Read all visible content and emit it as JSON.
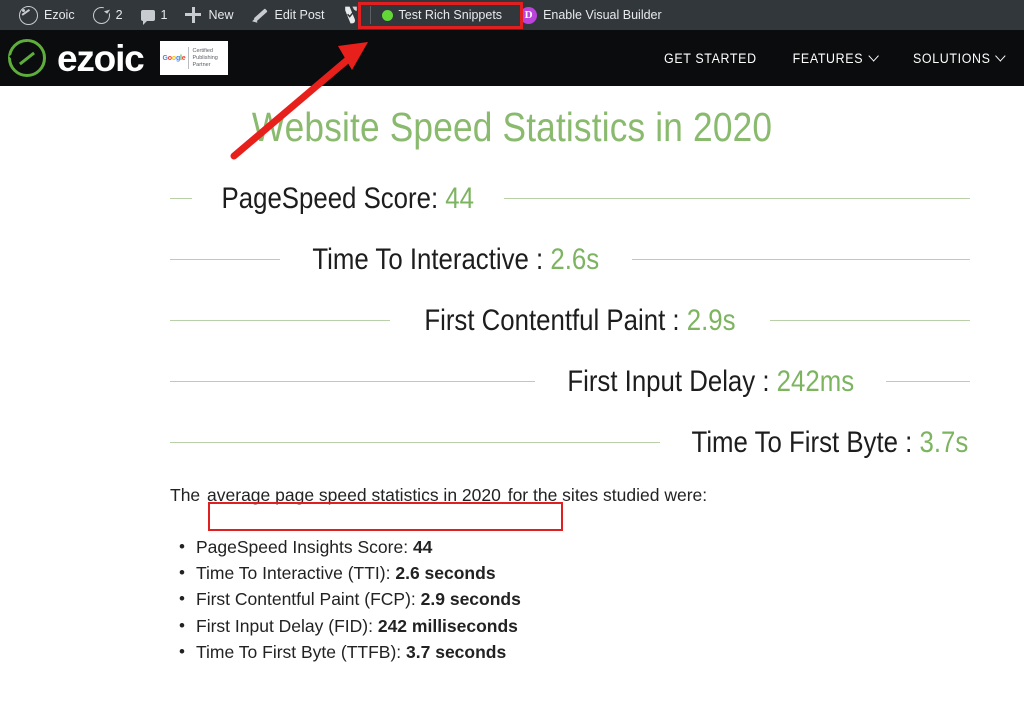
{
  "admin_bar": {
    "items": [
      {
        "icon": "ezoic-speedometer-icon",
        "label": "Ezoic",
        "name": "admin-bar-item-ezoic"
      },
      {
        "icon": "updates-refresh-icon",
        "label": "2",
        "name": "admin-bar-item-updates"
      },
      {
        "icon": "comment-bubble-icon",
        "label": "1",
        "name": "admin-bar-item-comments"
      },
      {
        "icon": "plus-icon",
        "label": "New",
        "name": "admin-bar-item-new"
      },
      {
        "icon": "pencil-icon",
        "label": "Edit Post",
        "name": "admin-bar-item-edit-post"
      },
      {
        "icon": "yoast-seo-icon",
        "label": "",
        "name": "admin-bar-item-yoast"
      },
      {
        "icon": "green-status-dot-icon",
        "label": "Test Rich Snippets",
        "name": "admin-bar-item-test-rich-snippets"
      },
      {
        "icon": "divi-d-icon",
        "label": "Enable Visual Builder",
        "name": "admin-bar-item-enable-visual-builder"
      }
    ],
    "divi_letter": "D",
    "background": "#32373c"
  },
  "site_header": {
    "brand_word": "ezoic",
    "badge": {
      "google": [
        {
          "ch": "G",
          "cls": "g-b"
        },
        {
          "ch": "o",
          "cls": "g-r"
        },
        {
          "ch": "o",
          "cls": "g-y"
        },
        {
          "ch": "g",
          "cls": "g-b"
        },
        {
          "ch": "l",
          "cls": "g-g"
        },
        {
          "ch": "e",
          "cls": "g-r"
        }
      ],
      "line1": "Certified",
      "line2": "Publishing",
      "line3": "Partner"
    },
    "nav": [
      {
        "label": "GET STARTED",
        "caret": false,
        "name": "nav-item-get-started"
      },
      {
        "label": "FEATURES",
        "caret": true,
        "name": "nav-item-features"
      },
      {
        "label": "SOLUTIONS",
        "caret": true,
        "name": "nav-item-solutions"
      }
    ],
    "background": "#0a0c0d",
    "accent": "#5fae3c"
  },
  "article": {
    "title": "Website Speed Statistics in 2020",
    "lead": {
      "before": "The ",
      "highlighted": "average page speed statistics in 2020",
      "after": " for the sites studied were:"
    },
    "stats": [
      {
        "label": "PageSpeed Score: ",
        "value": "44",
        "left_rule": 22,
        "name": "stat-row-pagespeed-score"
      },
      {
        "label": "Time To Interactive : ",
        "value": "2.6s",
        "left_rule": 110,
        "name": "stat-row-time-to-interactive"
      },
      {
        "label": "First Contentful Paint : ",
        "value": "2.9s",
        "left_rule": 220,
        "name": "stat-row-first-contentful-paint"
      },
      {
        "label": "First Input Delay : ",
        "value": "242ms",
        "left_rule": 365,
        "name": "stat-row-first-input-delay"
      },
      {
        "label": "Time To First Byte : ",
        "value": "3.7s",
        "left_rule": 490,
        "name": "stat-row-time-to-first-byte"
      }
    ],
    "bullets": [
      {
        "label": "PageSpeed Insights Score: ",
        "value": "44"
      },
      {
        "label": "Time To Interactive (TTI): ",
        "value": "2.6 seconds"
      },
      {
        "label": "First Contentful Paint (FCP): ",
        "value": "2.9 seconds"
      },
      {
        "label": "First Input Delay (FID): ",
        "value": "242 milliseconds"
      },
      {
        "label": "Time To First Byte (TTFB): ",
        "value": "3.7 seconds"
      }
    ],
    "title_color": "#8aba6e",
    "value_color": "#7cb460",
    "rule_color": "#b9cfa8"
  },
  "annotations": {
    "highlight_color": "#e02020",
    "box_topbar": "red-rectangle-around-test-rich-snippets",
    "box_phrase": "red-rectangle-around-average-page-speed-statistics-in-2020",
    "arrow": "red-arrow-pointing-to-test-rich-snippets"
  }
}
